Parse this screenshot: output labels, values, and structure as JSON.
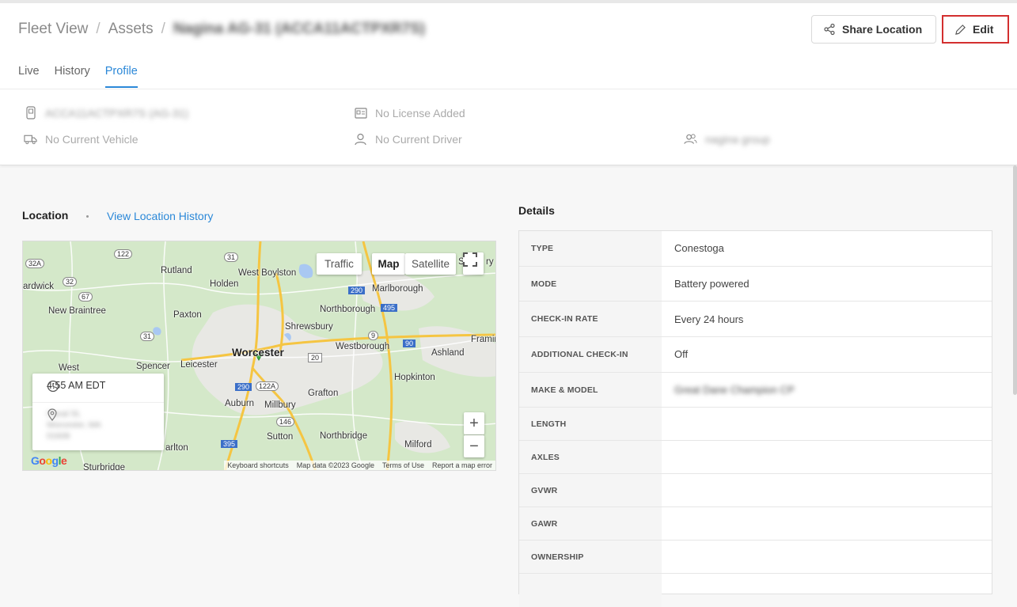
{
  "breadcrumb": {
    "root": "Fleet View",
    "section": "Assets",
    "current": "Nagina AG-31 (ACCA11ACTPXR7S)"
  },
  "actions": {
    "share_label": "Share Location",
    "edit_label": "Edit"
  },
  "tabs": [
    {
      "label": "Live",
      "active": false
    },
    {
      "label": "History",
      "active": false
    },
    {
      "label": "Profile",
      "active": true
    }
  ],
  "info": {
    "device": "ACCA11ACTPXR7S (AG-31)",
    "license": "No License Added",
    "vehicle": "No Current Vehicle",
    "driver": "No Current Driver",
    "group": "nagina group"
  },
  "location": {
    "title": "Location",
    "history_link": "View Location History",
    "map_type_map": "Map",
    "map_type_satellite": "Satellite",
    "traffic": "Traffic",
    "popup_time": "4:55 AM EDT",
    "popup_address_line1": "Canal St,",
    "popup_address_line2": "Worcester, MA",
    "popup_address_line3": "01608",
    "zoom_in": "+",
    "zoom_out": "−",
    "attribution": {
      "shortcuts": "Keyboard shortcuts",
      "data": "Map data ©2023 Google",
      "terms": "Terms of Use",
      "report": "Report a map error"
    },
    "google": "Google",
    "places": {
      "rutland": "Rutland",
      "west_boylston": "West Boylston",
      "holden": "Holden",
      "hardwick": "ardwick",
      "new_braintree": "New Braintree",
      "paxton": "Paxton",
      "northborough": "Northborough",
      "marlborough": "Marlborough",
      "shrewsbury": "Shrewsbury",
      "worcester": "Worcester",
      "westborough": "Westborough",
      "framingham": "Framinghar",
      "ashland": "Ashland",
      "west": "West",
      "spencer": "Spencer",
      "leicester": "Leicester",
      "hopkinton": "Hopkinton",
      "grafton": "Grafton",
      "auburn": "Auburn",
      "millbury": "Millbury",
      "sutton": "Sutton",
      "northbridge": "Northbridge",
      "milford": "Milford",
      "charlton": "arlton",
      "sturbridge": "Sturbridge",
      "shrews_s": "S",
      "shrews_ry": "ry"
    },
    "routes": {
      "r122": "122",
      "r32a": "32A",
      "r31a": "31",
      "r32": "32",
      "r67": "67",
      "r31b": "31",
      "r290a": "290",
      "r495": "495",
      "r9": "9",
      "r20": "20",
      "r90": "90",
      "r290b": "290",
      "r122a": "122A",
      "r146": "146",
      "r395": "395"
    }
  },
  "details": {
    "title": "Details",
    "rows": [
      {
        "key": "TYPE",
        "value": "Conestoga"
      },
      {
        "key": "MODE",
        "value": "Battery powered"
      },
      {
        "key": "CHECK-IN RATE",
        "value": "Every 24 hours"
      },
      {
        "key": "ADDITIONAL CHECK-IN",
        "value": "Off"
      },
      {
        "key": "MAKE & MODEL",
        "value": "Great Dane Champion CP"
      },
      {
        "key": "LENGTH",
        "value": ""
      },
      {
        "key": "AXLES",
        "value": ""
      },
      {
        "key": "GVWR",
        "value": ""
      },
      {
        "key": "GAWR",
        "value": ""
      },
      {
        "key": "OWNERSHIP",
        "value": ""
      }
    ]
  },
  "colors": {
    "accent": "#2b88d8",
    "edit_border": "#d32f2f",
    "map_land": "#d4e8c9",
    "map_urban": "#e8e8e4",
    "map_highway": "#f5c542",
    "map_water": "#a9c8f2"
  }
}
